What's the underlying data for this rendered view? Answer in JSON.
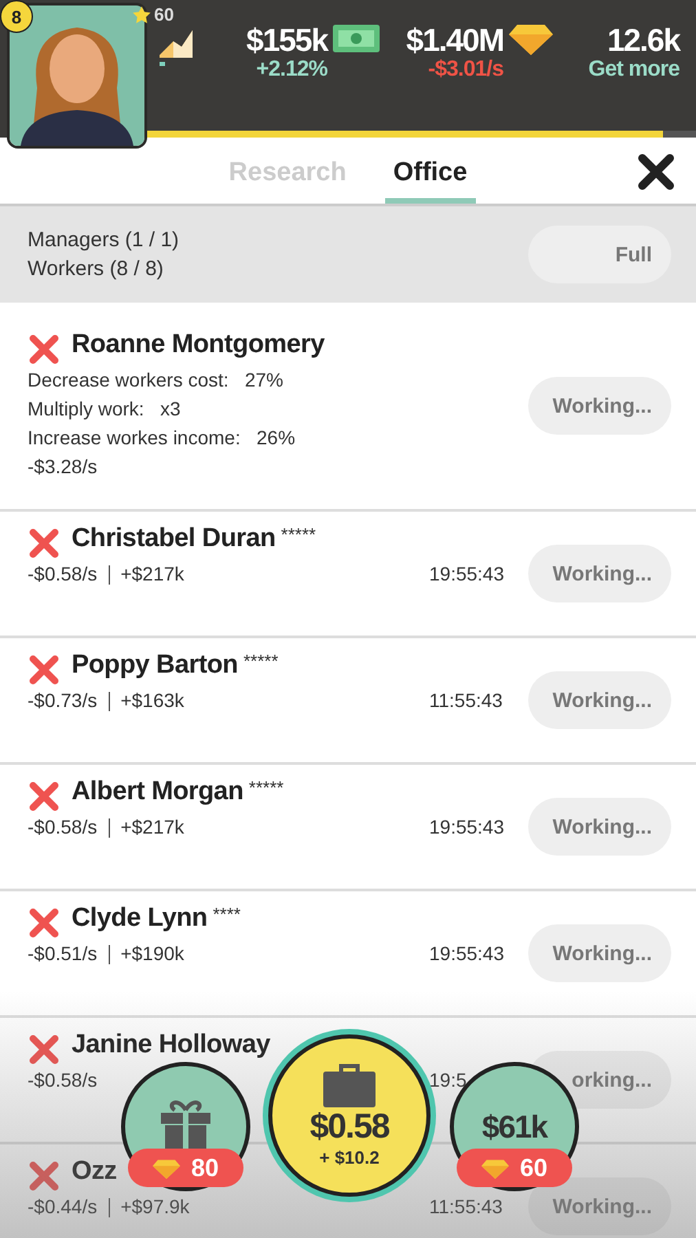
{
  "header": {
    "level": "8",
    "stars": "60",
    "xp": {
      "level": 0.94
    },
    "stats": [
      {
        "kind": "growth",
        "value": "$155k",
        "sub": "+2.12%",
        "negative": false
      },
      {
        "kind": "cash",
        "value": "$1.40M",
        "sub": "-$3.01/s",
        "negative": true
      },
      {
        "kind": "gem",
        "value": "12.6k",
        "sub": "Get more",
        "negative": false
      }
    ]
  },
  "tabs": [
    {
      "label": "Research",
      "selected": false
    },
    {
      "label": "Office",
      "selected": true
    }
  ],
  "summary": {
    "lines": [
      "Managers (1 / 1)",
      "Workers (8 / 8)"
    ],
    "button": "Full"
  },
  "staff": [
    {
      "kind": "manager",
      "name": "Roanne Montgomery",
      "effects": [
        "Decrease workers cost:   27%",
        "Multiply work:   x3",
        "Increase workes income:   26%"
      ],
      "rate": "-$3.28/s",
      "button": "Working..."
    },
    {
      "kind": "worker",
      "name": "Christabel Duran",
      "stars": "*****",
      "rate": "-$0.58/s",
      "income": "+$217k",
      "time": "19:55:43",
      "button": "Working..."
    },
    {
      "kind": "worker",
      "name": "Poppy Barton",
      "stars": "*****",
      "rate": "-$0.73/s",
      "income": "+$163k",
      "time": "11:55:43",
      "button": "Working..."
    },
    {
      "kind": "worker",
      "name": "Albert Morgan",
      "stars": "*****",
      "rate": "-$0.58/s",
      "income": "+$217k",
      "time": "19:55:43",
      "button": "Working..."
    },
    {
      "kind": "worker",
      "name": "Clyde Lynn",
      "stars": "****",
      "rate": "-$0.51/s",
      "income": "+$190k",
      "time": "19:55:43",
      "button": "Working..."
    },
    {
      "kind": "worker",
      "name": "Janine Holloway",
      "rate": "-$0.58/s",
      "time": "19:5",
      "button": "orking..."
    },
    {
      "kind": "worker",
      "name": "Ozz",
      "rate": "-$0.44/s",
      "income": "+$97.9k",
      "time": "11:55:43",
      "button": "Working..."
    }
  ],
  "actions": [
    {
      "kind": "gift",
      "price": "80"
    },
    {
      "kind": "collect",
      "value": "$0.58",
      "sub": "+ $10.2"
    },
    {
      "kind": "boost",
      "value": "$61k",
      "price": "60"
    }
  ]
}
